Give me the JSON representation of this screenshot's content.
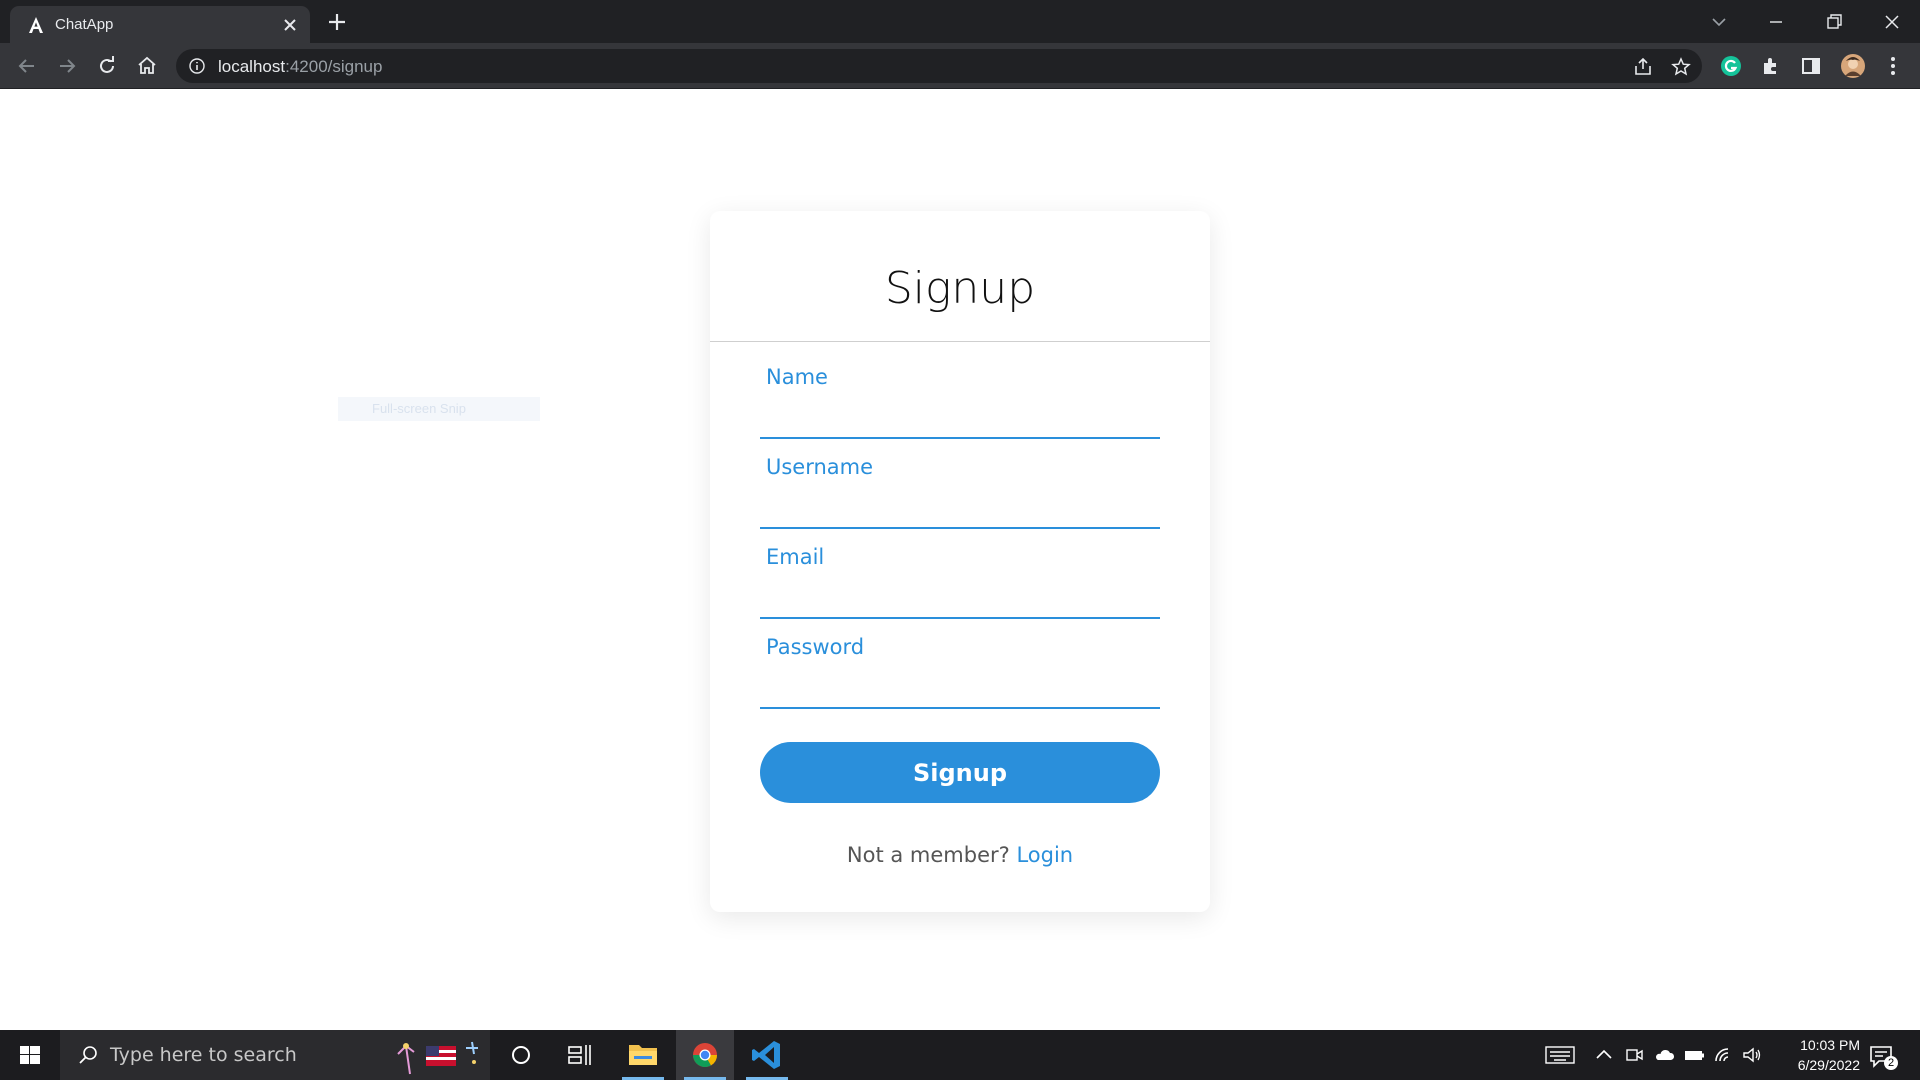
{
  "browser": {
    "tab_title": "ChatApp",
    "url_host": "localhost",
    "url_path": ":4200/signup"
  },
  "page": {
    "ghost_text": "Full-screen Snip",
    "title": "Signup",
    "fields": [
      {
        "label": "Name"
      },
      {
        "label": "Username"
      },
      {
        "label": "Email"
      },
      {
        "label": "Password"
      }
    ],
    "submit_label": "Signup",
    "footer_text": "Not a member?",
    "footer_link": "Login"
  },
  "taskbar": {
    "search_placeholder": "Type here to search",
    "time": "10:03 PM",
    "date": "6/29/2022",
    "notification_count": "2"
  },
  "colors": {
    "accent": "#2a8fdb",
    "chrome_dark": "#202124",
    "chrome_toolbar": "#35363a"
  }
}
